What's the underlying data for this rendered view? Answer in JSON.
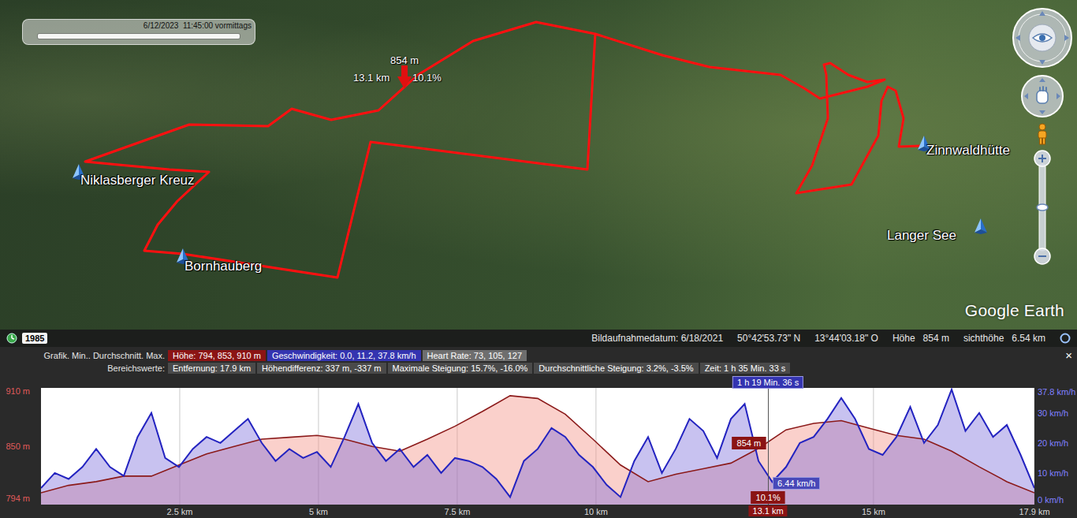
{
  "map": {
    "time_slider": {
      "label": "6/12/2023  11:45:00 vormittags",
      "level": 1.0
    },
    "placemarks": [
      {
        "name": "Niklasberger Kreuz"
      },
      {
        "name": "Bornhauberg"
      },
      {
        "name": "Zinnwaldhütte"
      },
      {
        "name": "Langer See"
      }
    ],
    "marker": {
      "elevation": "854 m",
      "distance": "13.1 km",
      "grade": "10.1%"
    },
    "logo": "Google Earth"
  },
  "status_bar": {
    "historical_year": "1985",
    "imagery_date": "Bildaufnahmedatum: 6/18/2021",
    "latitude": "50°42'53.73\" N",
    "longitude": "13°44'03.18\" O",
    "elevation_label": "Höhe",
    "elevation": "854 m",
    "eye_altitude_label": "sichthöhe",
    "eye_altitude": "6.54 km"
  },
  "profile": {
    "graph_label": "Grafik. Min.. Durchschnitt. Max.",
    "series_stats": [
      {
        "text": "Höhe: 794, 853, 910 m",
        "color": "#8b1414"
      },
      {
        "text": "Geschwindigkeit: 0.0, 11.2, 37.8 km/h",
        "color": "#3434b0"
      },
      {
        "text": "Heart Rate: 73, 105, 127",
        "color": "#6e6e6e"
      }
    ],
    "range_label": "Bereichswerte:",
    "range_values": [
      "Entfernung: 17.9 km",
      "Höhendifferenz: 337 m, -337 m",
      "Maximale Steigung: 15.7%, -16.0%",
      "Durchschnittliche Steigung: 3.2%, -3.5%",
      "Zeit: 1 h 35 Min. 33 s"
    ],
    "close": "×",
    "chart": {
      "elevation_axis": [
        "910 m",
        "850 m",
        "794 m"
      ],
      "speed_axis": [
        "37.8 km/h",
        "30 km/h",
        "20 km/h",
        "10 km/h",
        "0 km/h"
      ],
      "distance_axis": [
        "2.5 km",
        "5 km",
        "7.5 km",
        "10 km",
        "15 km",
        "17.9 km"
      ],
      "elevation_values": [
        800,
        808,
        812,
        818,
        818,
        830,
        842,
        850,
        858,
        860,
        862,
        858,
        850,
        845,
        858,
        872,
        888,
        905,
        902,
        885,
        858,
        830,
        812,
        820,
        826,
        832,
        848,
        868,
        875,
        878,
        870,
        862,
        858,
        845,
        828,
        812,
        800
      ],
      "speed_values": [
        5,
        10,
        8,
        12,
        18,
        12,
        9,
        22,
        30,
        15,
        12,
        18,
        22,
        20,
        24,
        28,
        20,
        14,
        18,
        15,
        17,
        12,
        22,
        33,
        20,
        14,
        18,
        12,
        16,
        10,
        15,
        14,
        12,
        8,
        2,
        14,
        18,
        25,
        22,
        16,
        12,
        6,
        2,
        14,
        22,
        10,
        18,
        28,
        24,
        15,
        28,
        33,
        14,
        7,
        12,
        20,
        22,
        28,
        35,
        28,
        18,
        16,
        22,
        32,
        20,
        26,
        37.8,
        24,
        30,
        22,
        26,
        16,
        5
      ],
      "cursor": {
        "distance": "13.1 km",
        "time": "1 h 19 Min. 36 s",
        "elevation": "854 m",
        "speed": "6.44 km/h",
        "grade": "10.1%"
      }
    }
  }
}
